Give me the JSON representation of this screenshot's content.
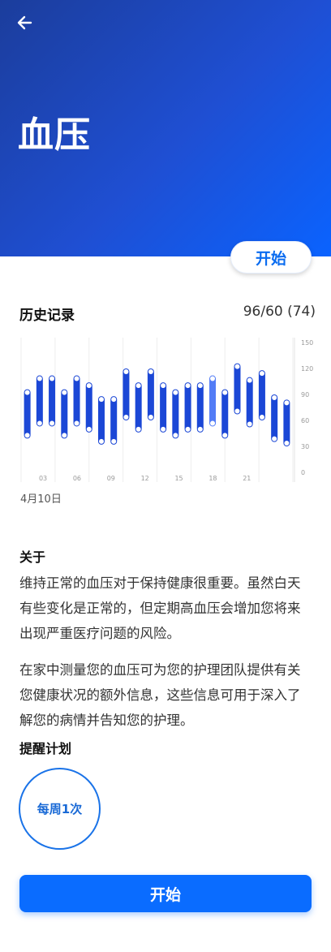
{
  "header": {
    "back_icon": "arrow-left-icon",
    "title": "血压",
    "gradient_colors": [
      "#1b3d9c",
      "#0a63ff"
    ]
  },
  "start_pill_label": "开始",
  "history": {
    "title": "历史记录",
    "latest_reading": "96/60 (74)",
    "date_label": "4月10日"
  },
  "chart_data": {
    "type": "bar",
    "subtype": "range",
    "x_tick_labels": [
      "03",
      "06",
      "09",
      "12",
      "15",
      "18",
      "21"
    ],
    "y_tick_labels": [
      "150",
      "120",
      "90",
      "60",
      "30",
      "0"
    ],
    "ylim": [
      0,
      150
    ],
    "y_axis_position": "right",
    "grid": "vertical",
    "bar_color": "#1b47d6",
    "highlight_color": "#3f6ef5",
    "x": [
      1,
      2,
      3,
      4,
      5,
      6,
      7,
      8,
      9,
      10,
      11,
      12,
      13,
      14,
      15,
      16,
      17,
      18,
      19,
      20,
      21,
      22
    ],
    "systolic": [
      96,
      112,
      112,
      96,
      112,
      104,
      88,
      88,
      120,
      104,
      120,
      104,
      96,
      104,
      104,
      112,
      96,
      126,
      110,
      118,
      90,
      84
    ],
    "diastolic": [
      39,
      53,
      53,
      39,
      53,
      46,
      32,
      32,
      60,
      46,
      60,
      46,
      39,
      46,
      46,
      53,
      39,
      67,
      52,
      60,
      35,
      30
    ],
    "highlighted_index": 15
  },
  "about": {
    "title": "关于",
    "paragraph_1": "维持正常的血压对于保持健康很重要。虽然白天有些变化是正常的，但定期高血压会增加您将来出现严重医疗问题的风险。",
    "paragraph_2": "在家中测量您的血压可为您的护理团队提供有关您健康状况的额外信息，这些信息可用于深入了解您的病情并告知您的护理。"
  },
  "reminder": {
    "title": "提醒计划",
    "frequency_label": "每周1次"
  },
  "primary_button_label": "开始"
}
